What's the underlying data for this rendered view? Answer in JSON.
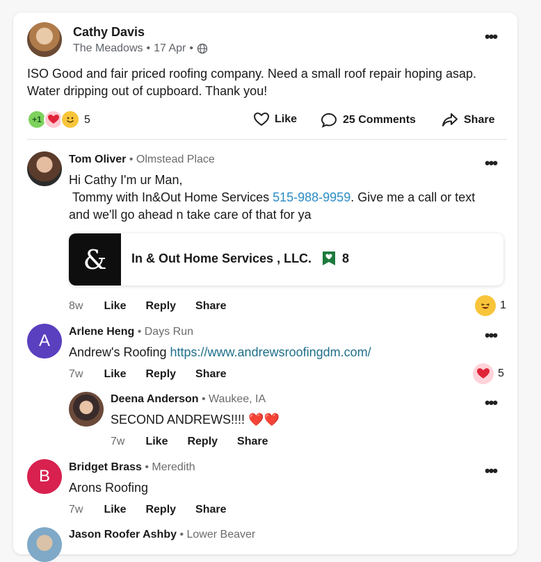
{
  "post": {
    "author": "Cathy Davis",
    "neighborhood": "The Meadows",
    "date": "17 Apr",
    "body": "ISO Good and fair priced roofing company. Need a small roof repair hoping asap. Water dripping out of cupboard. Thank you!",
    "reaction_count": "5",
    "reaction_plus": "+1",
    "actions": {
      "like": "Like",
      "comments": "25 Comments",
      "share": "Share"
    }
  },
  "comments": [
    {
      "author": "Tom Oliver",
      "location": "Olmstead Place",
      "text_line1": "Hi Cathy I'm ur Man,",
      "text_line2_pre": "Tommy with In&Out Home Services ",
      "phone": "515-988-9959",
      "text_line2_post": ".  Give me a call or text",
      "text_line3": "and we'll go ahead n take care of that for ya",
      "business": {
        "logo_text": "&",
        "name": "In & Out Home Services , LLC.",
        "recommendations": "8"
      },
      "age": "8w",
      "like": "Like",
      "reply": "Reply",
      "share": "Share",
      "reaction_count": "1"
    },
    {
      "author": "Arlene Heng",
      "location": "Days Run",
      "initial": "A",
      "text_pre": "Andrew's Roofing ",
      "url": "https://www.andrewsroofingdm.com/",
      "age": "7w",
      "like": "Like",
      "reply": "Reply",
      "share": "Share",
      "reaction_count": "5"
    },
    {
      "author": "Deena Anderson",
      "location": "Waukee, IA",
      "text": "SECOND ANDREWS!!!! ❤️❤️",
      "age": "7w",
      "like": "Like",
      "reply": "Reply",
      "share": "Share"
    },
    {
      "author": "Bridget Brass",
      "location": "Meredith",
      "initial": "B",
      "text": "Arons Roofing",
      "age": "7w",
      "like": "Like",
      "reply": "Reply",
      "share": "Share"
    },
    {
      "author": "Jason Roofer Ashby",
      "location": "Lower Beaver"
    }
  ],
  "icons": {
    "more": "more-icon",
    "globe": "globe-icon",
    "like": "heart-outline-icon",
    "comment": "comment-bubble-icon",
    "share": "share-arrow-icon",
    "recommend": "bookmark-heart-icon"
  },
  "colors": {
    "link": "#2b8cc4",
    "avatar_a": "#5a3fbf",
    "avatar_b": "#d8214f",
    "recommend": "#1e7a3c"
  }
}
